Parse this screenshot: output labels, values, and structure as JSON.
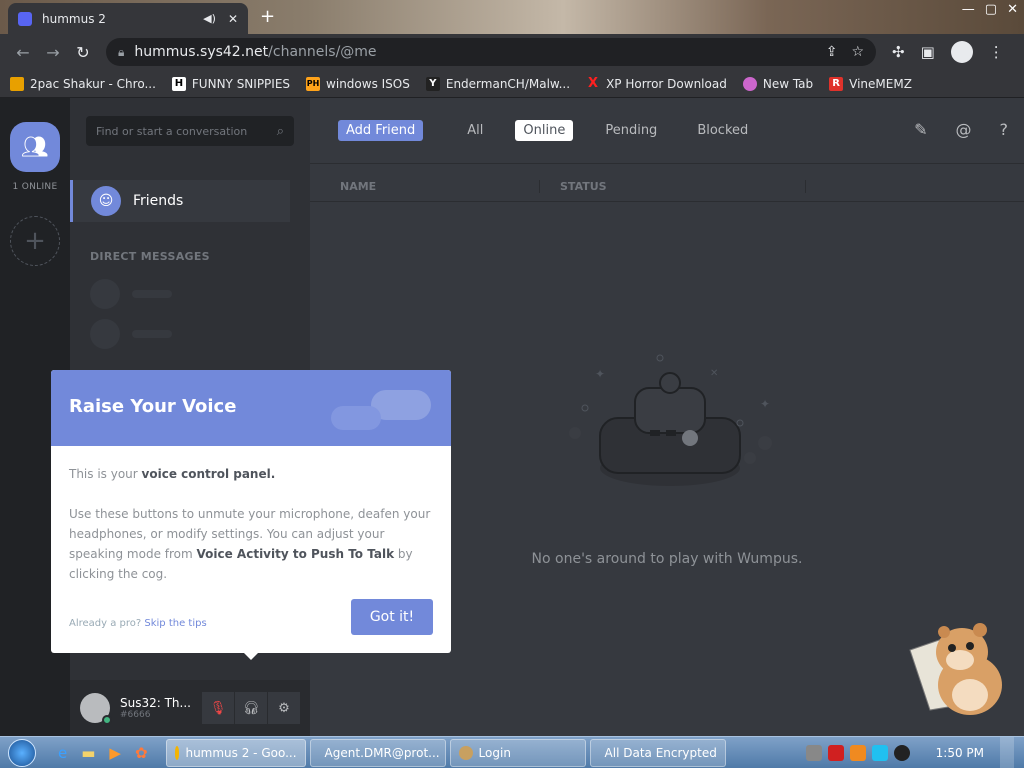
{
  "browser": {
    "tab_title": "hummus 2",
    "new_tab": "+",
    "url_host": "hummus.sys42.net",
    "url_path": "/channels/@me",
    "bookmarks": [
      {
        "label": "2pac Shakur - Chro...",
        "color": "#e8a000"
      },
      {
        "label": "FUNNY SNIPPIES",
        "icon_text": "H",
        "color": "#ffffff"
      },
      {
        "label": "windows ISOS",
        "icon_text": "PH",
        "color": "#ffa31a"
      },
      {
        "label": "EndermanCH/Malw...",
        "icon_text": "Y",
        "color": "#888888"
      },
      {
        "label": "XP Horror Download",
        "icon_text": "X",
        "color": "#ff2020"
      },
      {
        "label": "New Tab",
        "color": "#cc66cc"
      },
      {
        "label": "VineMEMZ",
        "icon_text": "R",
        "color": "#e0322b"
      }
    ]
  },
  "guilds": {
    "online_count": "1 ONLINE"
  },
  "sidebar": {
    "search_placeholder": "Find or start a conversation",
    "friends_label": "Friends",
    "dm_header": "DIRECT MESSAGES"
  },
  "user": {
    "name": "Sus32: Th...",
    "tag": "#6666"
  },
  "friends": {
    "add_friend": "Add Friend",
    "tabs": [
      "All",
      "Online",
      "Pending",
      "Blocked"
    ],
    "active_tab": "Online",
    "col_name": "NAME",
    "col_status": "STATUS",
    "empty_text": "No one's around to play with Wumpus."
  },
  "popup": {
    "title": "Raise Your Voice",
    "line1_pre": "This is your ",
    "line1_bold": "voice control panel.",
    "line2_pre": "Use these buttons to unmute your microphone, deafen your headphones, or modify settings. You can adjust your speaking mode from ",
    "line2_bold": "Voice Activity to Push To Talk",
    "line2_post": " by clicking the cog.",
    "foot_pre": "Already a pro? ",
    "foot_link": "Skip the tips",
    "button": "Got it!"
  },
  "taskbar": {
    "items": [
      {
        "label": "hummus 2 - Goo...",
        "color": "#f4b400"
      },
      {
        "label": "Agent.DMR@prot...",
        "color": "#cccccc"
      },
      {
        "label": "Login",
        "color": "#c8a060"
      },
      {
        "label": "All Data Encrypted",
        "color": "#dddddd"
      }
    ],
    "clock": "1:50 PM"
  }
}
